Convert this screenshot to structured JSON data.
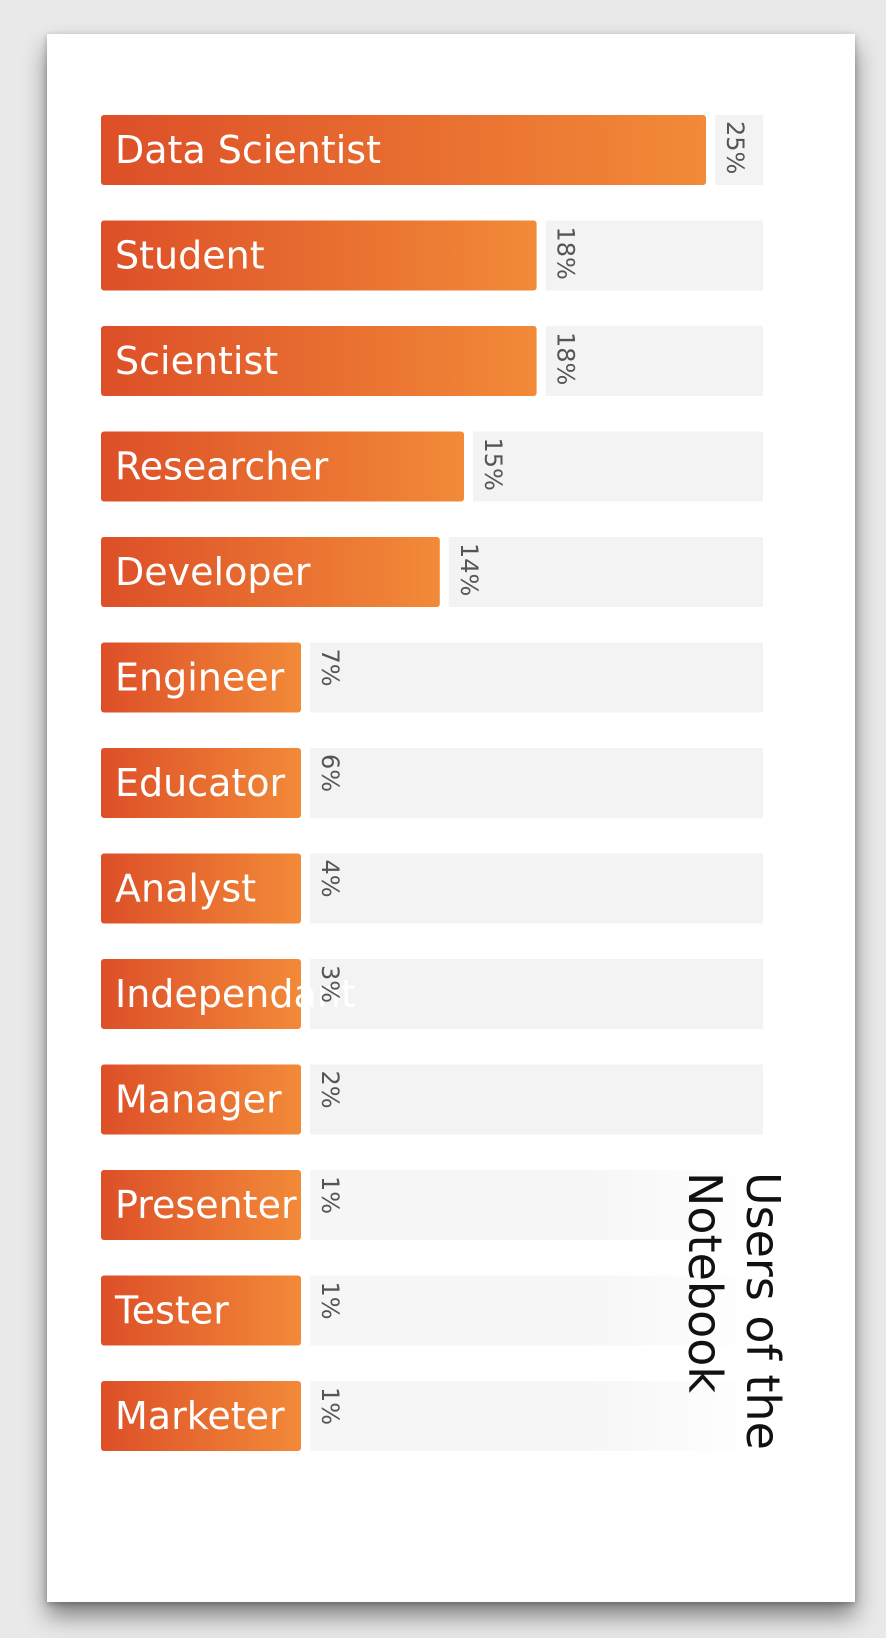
{
  "chart_data": {
    "type": "bar",
    "orientation": "horizontal",
    "title_lines": [
      "Users of the",
      "Notebook"
    ],
    "categories": [
      "Data Scientist",
      "Student",
      "Scientist",
      "Researcher",
      "Developer",
      "Engineer",
      "Educator",
      "Analyst",
      "Independant",
      "Manager",
      "Presenter",
      "Tester",
      "Marketer"
    ],
    "values": [
      25,
      18,
      18,
      15,
      14,
      7,
      6,
      4,
      3,
      2,
      1,
      1,
      1
    ],
    "value_labels": [
      "25%",
      "18%",
      "18%",
      "15%",
      "14%",
      "7%",
      "6%",
      "4%",
      "3%",
      "2%",
      "1%",
      "1%",
      "1%"
    ],
    "unit": "%",
    "xlim": [
      0,
      25
    ],
    "grid": false,
    "legend": "none",
    "colors": {
      "bar_start": "#dd4f28",
      "bar_end": "#f28a38",
      "track": "#f3f3f3",
      "value_text": "#555555",
      "label_text": "#ffffff",
      "title_text": "#111111"
    }
  }
}
